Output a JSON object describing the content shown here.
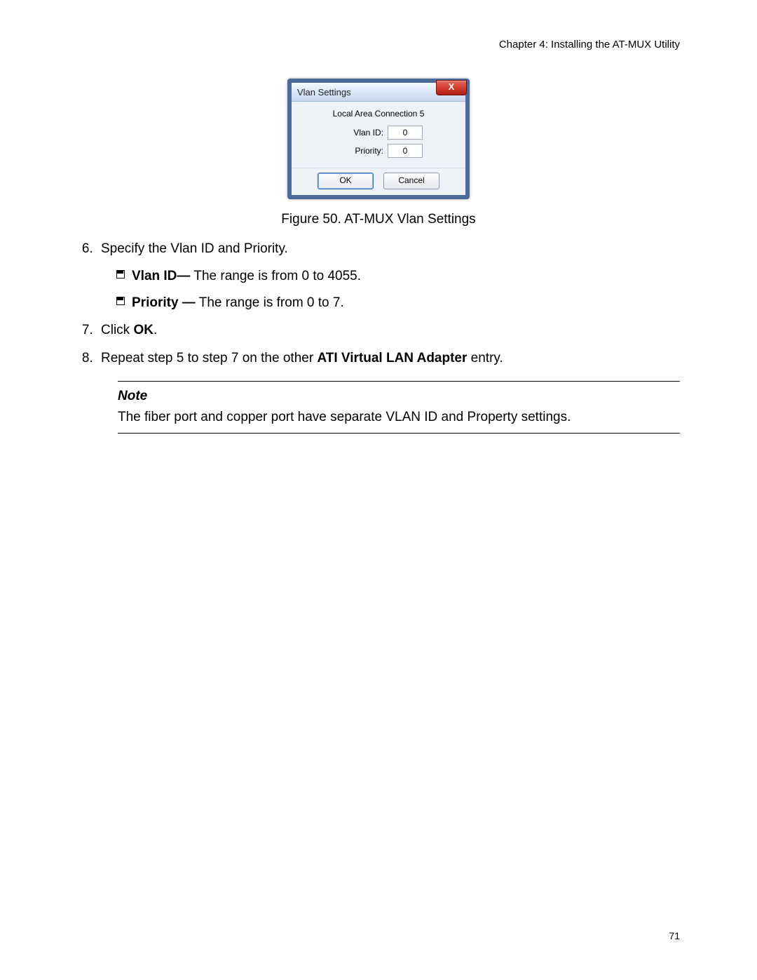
{
  "header": {
    "chapter": "Chapter 4: Installing the AT-MUX Utility"
  },
  "dialog": {
    "title": "Vlan Settings",
    "close_label": "X",
    "connection": "Local Area Connection 5",
    "vlan_id_label": "Vlan ID:",
    "vlan_id_value": "0",
    "priority_label": "Priority:",
    "priority_value": "0",
    "ok_label": "OK",
    "cancel_label": "Cancel"
  },
  "caption": "Figure 50. AT-MUX Vlan Settings",
  "steps": {
    "s6": "Specify the Vlan ID and Priority.",
    "vlan_id_bold": "Vlan ID—",
    "vlan_id_text": " The range is from 0 to 4055.",
    "priority_bold": "Priority —",
    "priority_text": " The range is from 0 to 7.",
    "s7_pre": "Click ",
    "s7_bold": "OK",
    "s7_post": ".",
    "s8_pre": "Repeat step 5 to step 7 on the other ",
    "s8_bold": "ATI Virtual LAN Adapter",
    "s8_post": " entry."
  },
  "note": {
    "title": "Note",
    "text": "The fiber port and copper port have separate VLAN ID and Property settings."
  },
  "page_number": "71"
}
